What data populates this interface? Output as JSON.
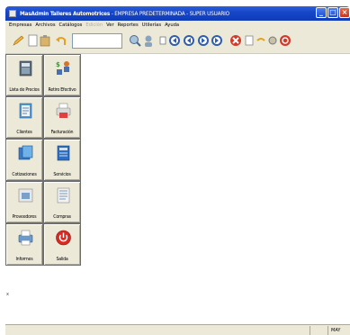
{
  "window": {
    "title_app": "MasAdmin Talleres Automotrices",
    "title_rest": " - EMPRESA PREDETERMINADA - SUPER USUARIO"
  },
  "menu": [
    "Empresas",
    "Archivos",
    "Catálogos",
    "Edición",
    "Ver",
    "Reportes",
    "Utilerías",
    "Ayuda"
  ],
  "search": {
    "value": ""
  },
  "modules": [
    {
      "label": "Lista de Precios",
      "icon": "price-list-icon"
    },
    {
      "label": "Retiro Efectivo",
      "icon": "cash-withdrawal-icon"
    },
    {
      "label": "Clientes",
      "icon": "clients-icon"
    },
    {
      "label": "Facturación",
      "icon": "invoice-printer-icon"
    },
    {
      "label": "Cotizaciones",
      "icon": "quotes-icon"
    },
    {
      "label": "Servicios",
      "icon": "services-icon"
    },
    {
      "label": "Proveedores",
      "icon": "suppliers-icon"
    },
    {
      "label": "Compras",
      "icon": "purchases-icon"
    },
    {
      "label": "Informes",
      "icon": "reports-icon"
    },
    {
      "label": "Salida",
      "icon": "exit-icon"
    }
  ],
  "status": {
    "caps": "MAY"
  }
}
